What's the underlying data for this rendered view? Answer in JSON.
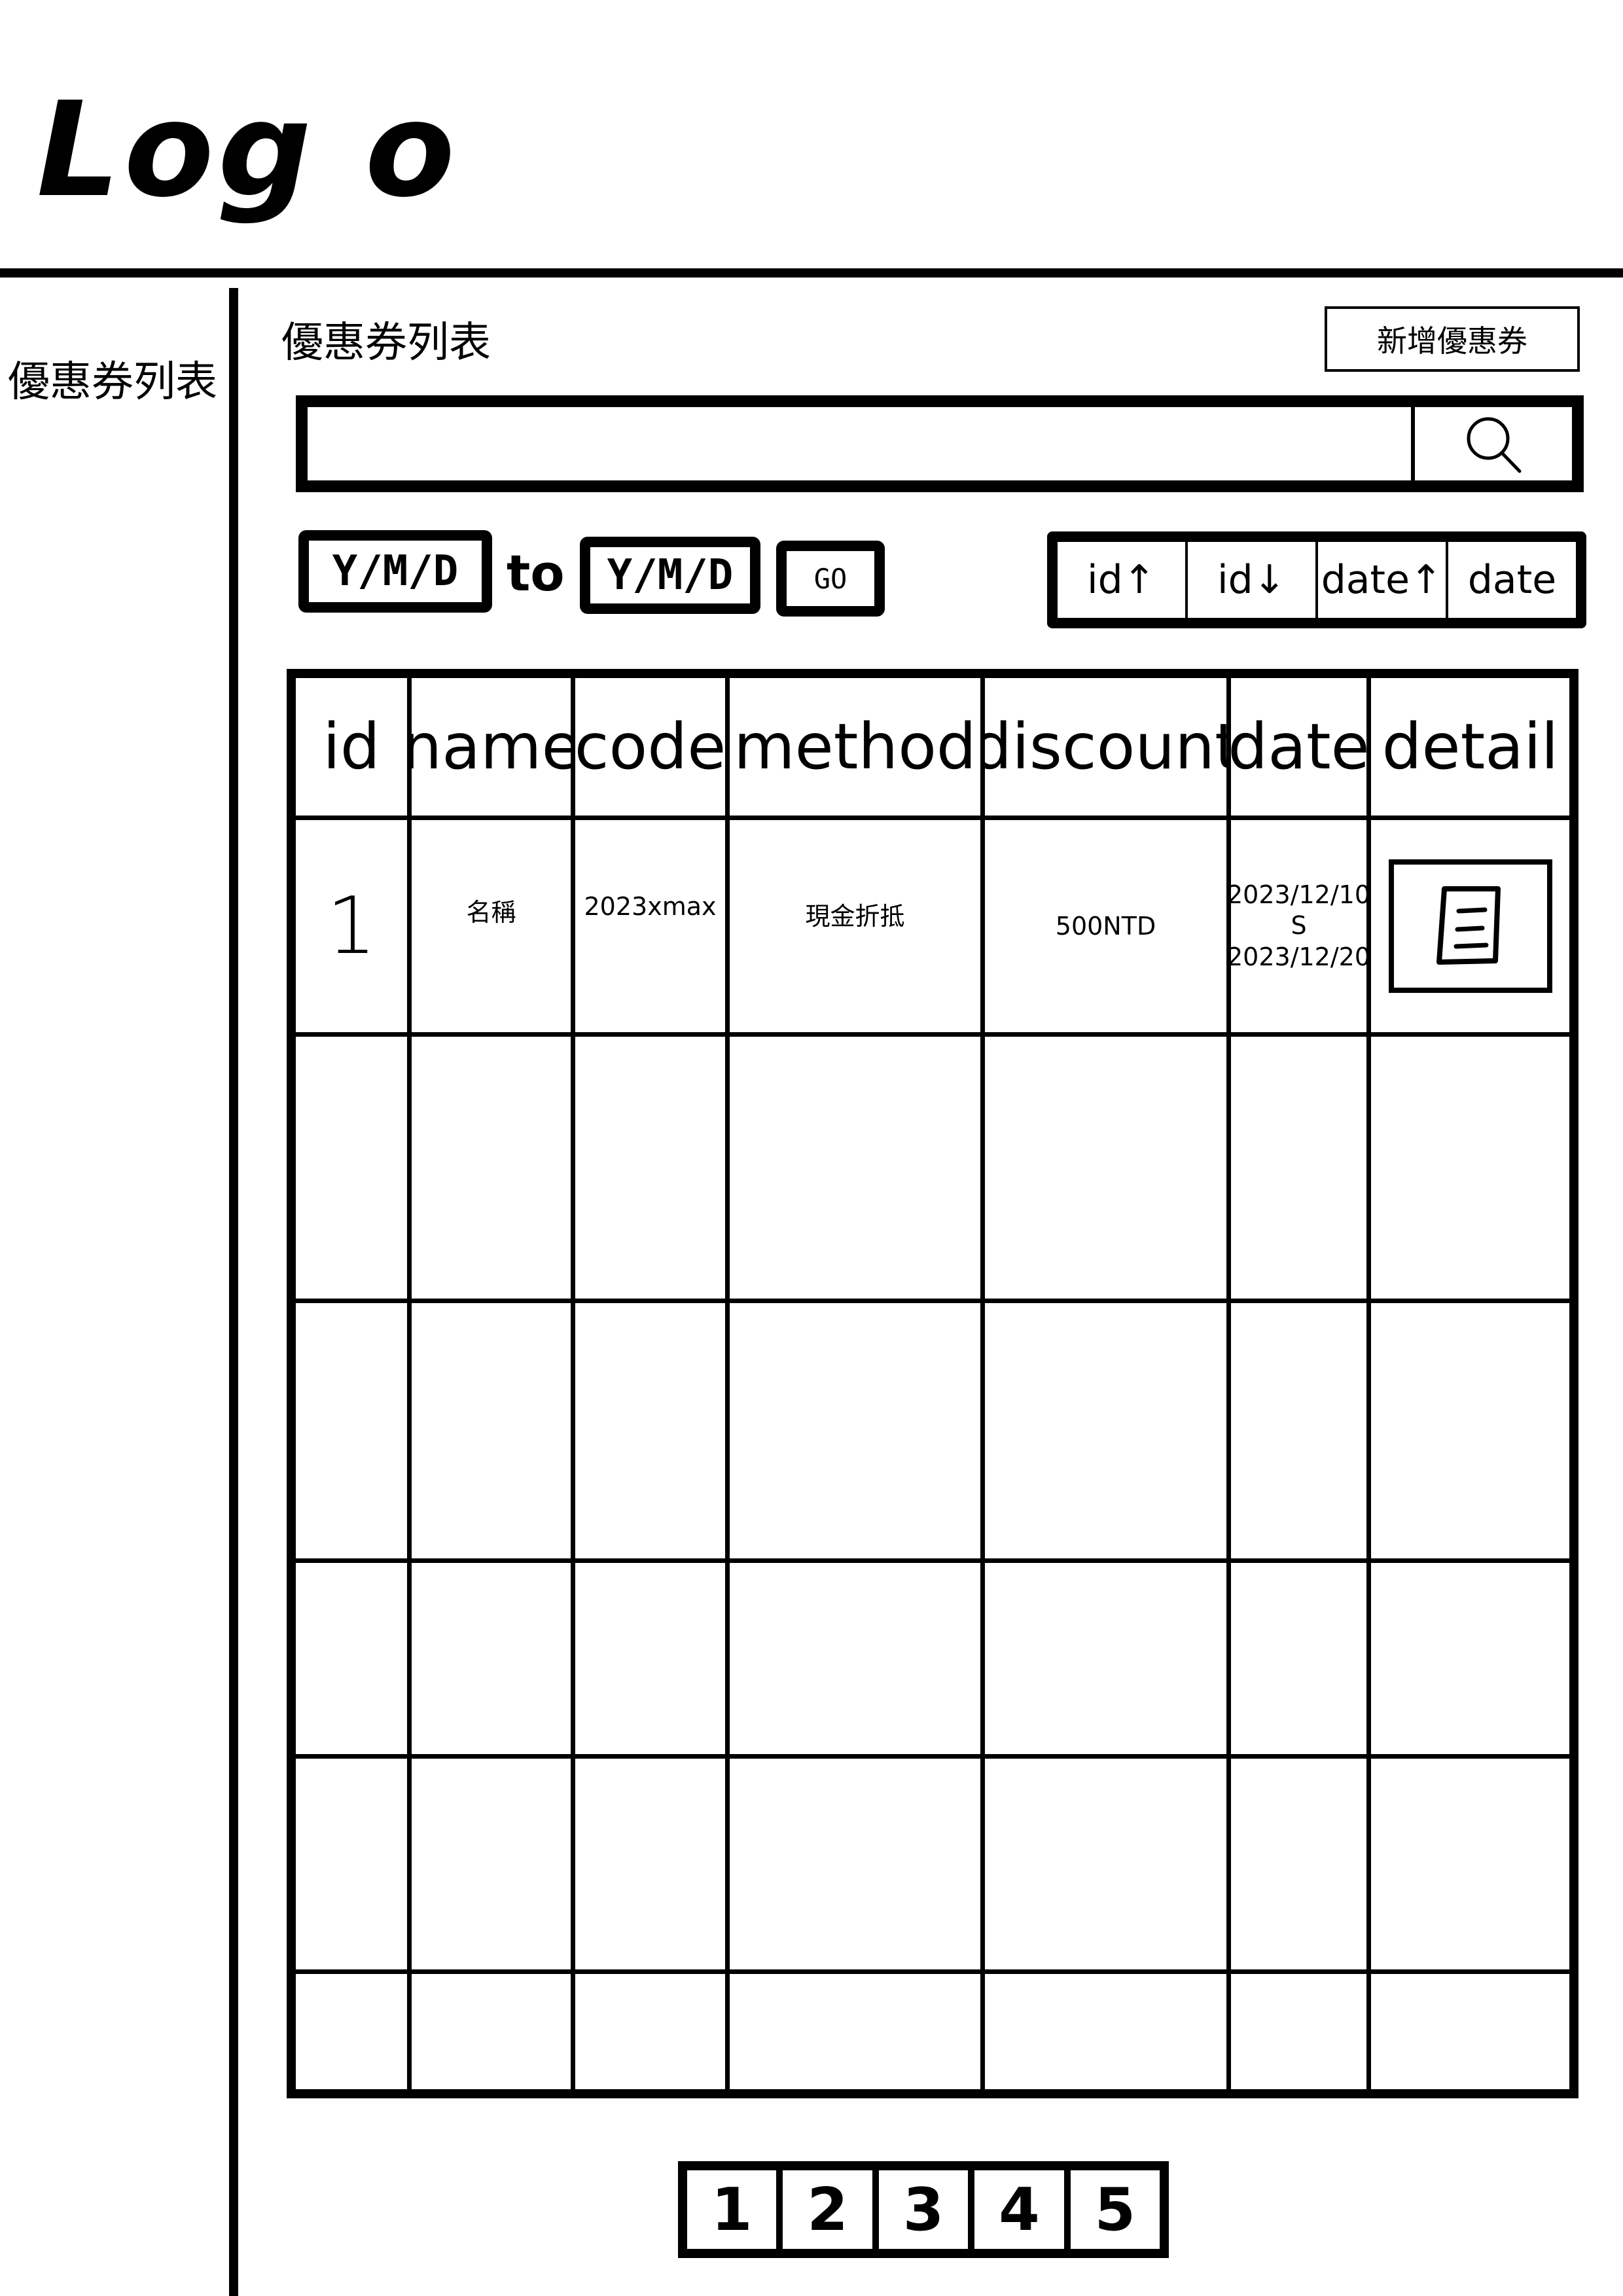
{
  "header": {
    "logo_text": "Log o"
  },
  "sidebar": {
    "items": [
      {
        "label": "優惠券列表"
      }
    ]
  },
  "main": {
    "title": "優惠券列表",
    "add_button_label": "新增優惠券",
    "search": {
      "value": "",
      "icon": "search-icon"
    },
    "date_filter": {
      "from_value": "Y/M/D",
      "to_label": "to",
      "to_value": "Y/M/D",
      "go_label": "GO"
    },
    "sort": {
      "options": [
        "id↑",
        "id↓",
        "date↑",
        "date"
      ]
    },
    "table": {
      "columns": [
        "id",
        "name",
        "code",
        "method",
        "discount",
        "date",
        "detail"
      ],
      "rows": [
        {
          "id": "1",
          "name": "名稱",
          "code": "2023xmax",
          "method": "現金折抵",
          "discount": "500NTD",
          "date_start": "2023/12/10",
          "date_sep": "S",
          "date_end": "2023/12/20",
          "detail_icon": "document-icon"
        }
      ]
    },
    "pagination": {
      "pages": [
        "1",
        "2",
        "3",
        "4",
        "5"
      ]
    }
  }
}
